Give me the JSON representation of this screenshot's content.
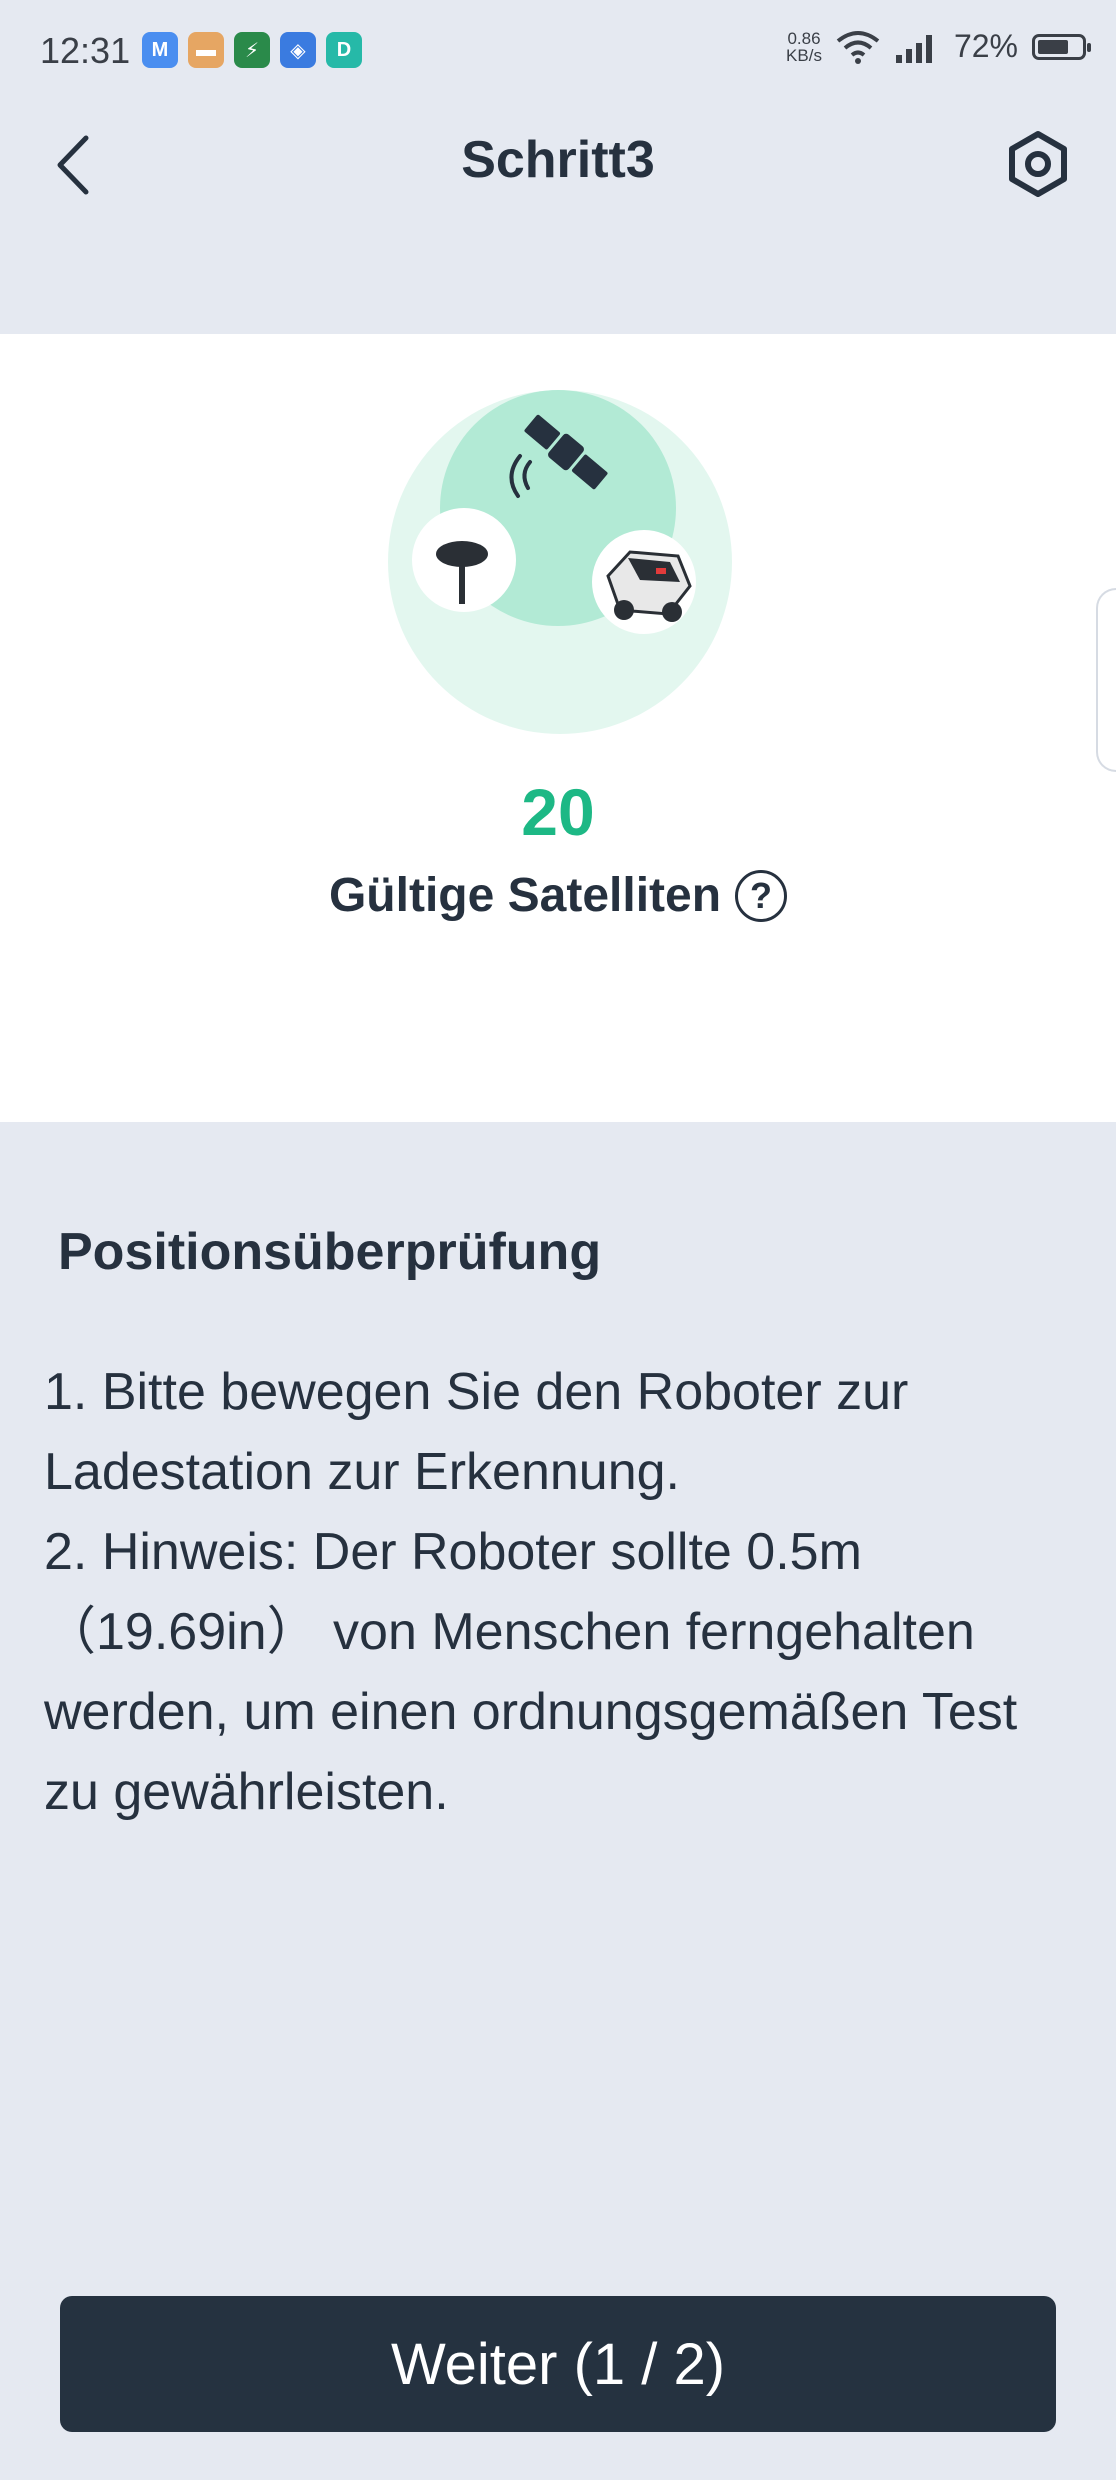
{
  "status_bar": {
    "time": "12:31",
    "net_speed_value": "0.86",
    "net_speed_unit": "KB/s",
    "battery_percent": "72%",
    "battery_level": 0.72,
    "app_icons": [
      "mail-icon",
      "box-icon",
      "battery-saver-icon",
      "shield-icon",
      "d-app-icon"
    ]
  },
  "header": {
    "title": "Schritt3"
  },
  "satellite_card": {
    "count": "20",
    "label": "Gültige Satelliten",
    "help_icon": "?"
  },
  "section": {
    "title": "Positionsüberprüfung",
    "instructions": [
      "1. Bitte bewegen Sie den Roboter zur Ladestation zur Erkennung.",
      "2. Hinweis: Der Roboter sollte 0.5m （19.69in） von Menschen ferngehalten werden, um einen ordnungsgemäßen Test zu gewährleisten."
    ]
  },
  "footer": {
    "next_button": "Weiter (1 / 2)"
  },
  "colors": {
    "accent_green": "#1db885",
    "dark_button": "#253240",
    "background": "#e5e9f1"
  }
}
